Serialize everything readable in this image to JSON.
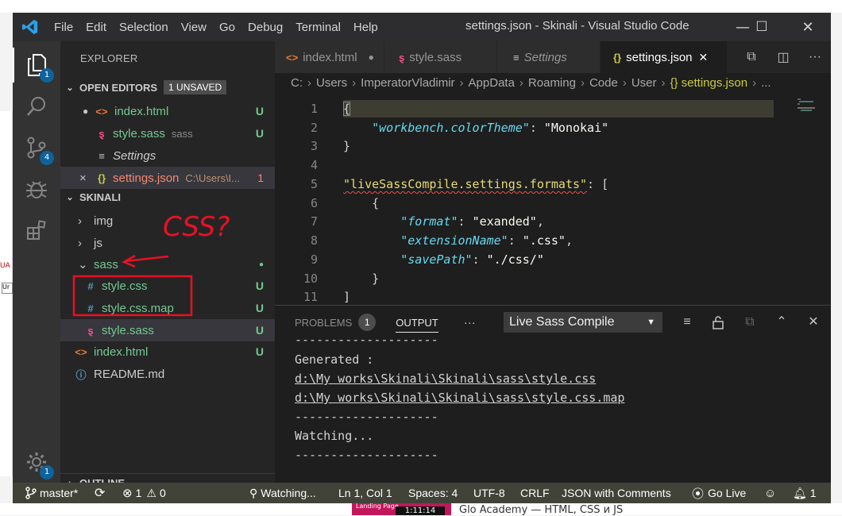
{
  "background": {
    "video_label": "Landing Page",
    "video_time": "1:11:14",
    "video_title": "Glo Academy — HTML, CSS и JS",
    "edge_text": "UA",
    "edge_box": "Ur"
  },
  "titlebar": {
    "menu": [
      "File",
      "Edit",
      "Selection",
      "View",
      "Go",
      "Debug",
      "Terminal",
      "Help"
    ],
    "title": "settings.json - Skinali - Visual Studio Code",
    "minimize": "—",
    "maximize": "☐",
    "close": "✕"
  },
  "activitybar": {
    "explorer_badge": "1",
    "scm_badge": "4",
    "settings_badge": "1"
  },
  "sidebar": {
    "title": "EXPLORER",
    "open_editors": {
      "label": "OPEN EDITORS",
      "badge": "1 UNSAVED",
      "items": [
        {
          "dot": "●",
          "icon": "<>",
          "name": "index.html",
          "desc": "",
          "status": "U"
        },
        {
          "dot": "",
          "icon": "ȿ",
          "name": "style.sass",
          "desc": "sass",
          "status": "U"
        },
        {
          "dot": "",
          "icon": "≡",
          "name": "Settings",
          "desc": "",
          "status": ""
        },
        {
          "dot": "×",
          "icon": "{}",
          "name": "settings.json",
          "desc": "C:\\Users\\I...",
          "status": "1"
        }
      ]
    },
    "project": {
      "label": "SKINALI",
      "items": [
        {
          "chev": "›",
          "icon": "",
          "name": "img",
          "status": ""
        },
        {
          "chev": "›",
          "icon": "",
          "name": "js",
          "status": ""
        },
        {
          "chev": "⌄",
          "icon": "",
          "name": "sass",
          "status": "●"
        },
        {
          "chev": "",
          "icon": "#",
          "name": "style.css",
          "status": "U"
        },
        {
          "chev": "",
          "icon": "#",
          "name": "style.css.map",
          "status": "U"
        },
        {
          "chev": "",
          "icon": "ȿ",
          "name": "style.sass",
          "status": "U"
        },
        {
          "chev": "",
          "icon": "<>",
          "name": "index.html",
          "status": "U"
        },
        {
          "chev": "",
          "icon": "ⓘ",
          "name": "README.md",
          "status": ""
        }
      ]
    },
    "outline": "OUTLINE",
    "annotation": "CSS?"
  },
  "tabs": [
    {
      "icon": "<>",
      "label": "index.html",
      "mark": "●"
    },
    {
      "icon": "ȿ",
      "label": "style.sass",
      "mark": ""
    },
    {
      "icon": "≡",
      "label": "Settings",
      "mark": ""
    },
    {
      "icon": "{}",
      "label": "settings.json",
      "mark": "✕"
    }
  ],
  "breadcrumb": [
    "C:",
    "Users",
    "ImperatorVladimir",
    "AppData",
    "Roaming",
    "Code",
    "User",
    "{} settings.json",
    "..."
  ],
  "editor": {
    "line_numbers": [
      "1",
      "2",
      "3",
      "4",
      "5",
      "6",
      "7",
      "8",
      "9",
      "10",
      "11"
    ],
    "l1": "{",
    "l2_key": "\"workbench.colorTheme\"",
    "l2_sep": ": ",
    "l2_val": "\"Monokai\"",
    "l3": "}",
    "l5_key": "\"liveSassCompile.settings.formats\"",
    "l5_rest": ": [",
    "l6": "{",
    "l7_key": "\"format\"",
    "l7_val": "\"exanded\"",
    "l8_key": "\"extensionName\"",
    "l8_val": "\".css\"",
    "l9_key": "\"savePath\"",
    "l9_val": "\"./css/\"",
    "l10": "}",
    "l11": "]"
  },
  "panel": {
    "problems": "PROBLEMS",
    "problems_count": "1",
    "output": "OUTPUT",
    "more": "···",
    "channel": "Live Sass Compile",
    "lines": [
      "--------------------",
      "Generated :",
      "d:\\My works\\Skinali\\Skinali\\sass\\style.css",
      "d:\\My works\\Skinali\\Skinali\\sass\\style.css.map",
      "--------------------",
      "Watching...",
      "--------------------"
    ]
  },
  "statusbar": {
    "branch": "master*",
    "errors": "1",
    "warnings": "0",
    "watching": "Watching...",
    "position": "Ln 1, Col 1",
    "spaces": "Spaces: 4",
    "encoding": "UTF-8",
    "eol": "CRLF",
    "language": "JSON with Comments",
    "golive": "Go Live",
    "notifications": "1"
  },
  "colors": {
    "accent": "#0e639c",
    "git_untracked": "#73c991",
    "annotation_red": "#e81123"
  }
}
